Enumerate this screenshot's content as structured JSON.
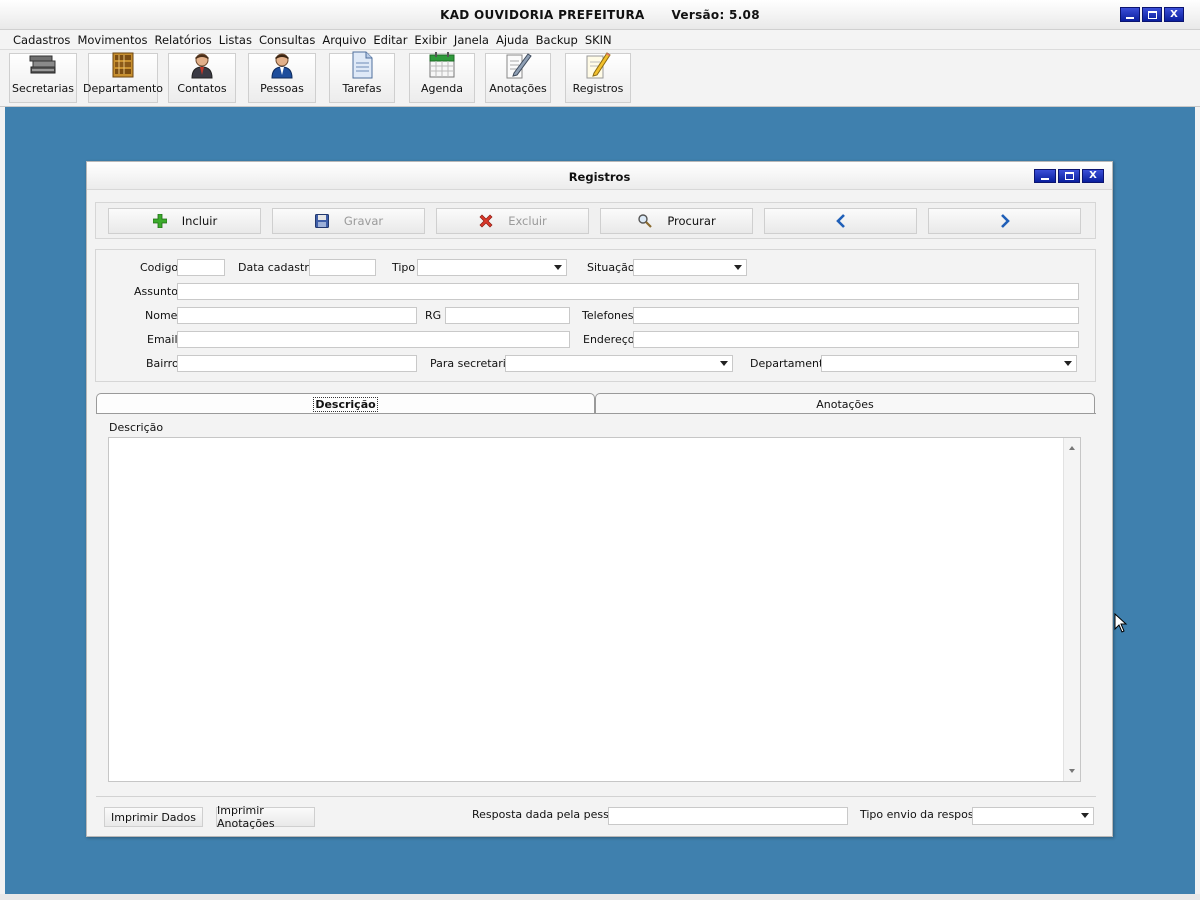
{
  "app": {
    "title": "KAD OUVIDORIA PREFEITURA      Versão: 5.08",
    "window_buttons": {
      "minimize": "▁",
      "maximize": "□",
      "close": "X"
    }
  },
  "menu": [
    "Cadastros",
    "Movimentos",
    "Relatórios",
    "Listas",
    "Consultas",
    "Arquivo",
    "Editar",
    "Exibir",
    "Janela",
    "Ajuda",
    "Backup",
    "SKIN"
  ],
  "toolbar": {
    "items": [
      {
        "label": "Secretarias",
        "icon": "books-stack-icon"
      },
      {
        "label": "Departamento",
        "icon": "bookshelf-icon"
      },
      {
        "label": "Contatos",
        "icon": "person-icon"
      },
      {
        "label": "Pessoas",
        "icon": "person-blue-icon"
      },
      {
        "label": "Tarefas",
        "icon": "document-icon"
      },
      {
        "label": "Agenda",
        "icon": "calendar-icon"
      },
      {
        "label": "Anotações",
        "icon": "notepad-pen-icon"
      },
      {
        "label": "Registros",
        "icon": "pencil-note-icon"
      }
    ]
  },
  "registros": {
    "title": "Registros",
    "window_buttons": {
      "minimize": "▁",
      "maximize": "□",
      "close": "X"
    },
    "actions": {
      "incluir": "Incluir",
      "gravar": "Gravar",
      "excluir": "Excluir",
      "procurar": "Procurar",
      "prev": "",
      "next": ""
    },
    "form": {
      "codigo": {
        "label": "Codigo",
        "value": ""
      },
      "data_cadastro": {
        "label": "Data cadastro",
        "value": ""
      },
      "tipo": {
        "label": "Tipo",
        "value": ""
      },
      "situacao": {
        "label": "Situação",
        "value": ""
      },
      "assunto": {
        "label": "Assunto",
        "value": ""
      },
      "nome": {
        "label": "Nome",
        "value": ""
      },
      "rg": {
        "label": "RG",
        "value": ""
      },
      "telefones": {
        "label": "Telefones",
        "value": ""
      },
      "email": {
        "label": "Email",
        "value": ""
      },
      "endereco": {
        "label": "Endereço",
        "value": ""
      },
      "bairro": {
        "label": "Bairro",
        "value": ""
      },
      "para_secretaria": {
        "label": "Para secretaria",
        "value": ""
      },
      "departamento": {
        "label": "Departamento",
        "value": ""
      }
    },
    "tabs": [
      {
        "label": "Descrição",
        "active": true
      },
      {
        "label": "Anotações",
        "active": false
      }
    ],
    "descricao": {
      "label": "Descrição",
      "value": ""
    },
    "bottom": {
      "imprimir_dados": "Imprimir Dados",
      "imprimir_anotacoes": "Imprimir Anotações",
      "resposta_label": "Resposta dada pela pessoa",
      "resposta_value": "",
      "tipo_envio_label": "Tipo envio da resposta",
      "tipo_envio_value": ""
    }
  },
  "colors": {
    "desktop": "#3f80ae",
    "window_button": "#0a1f9e",
    "accent_blue": "#1f5fb8"
  }
}
